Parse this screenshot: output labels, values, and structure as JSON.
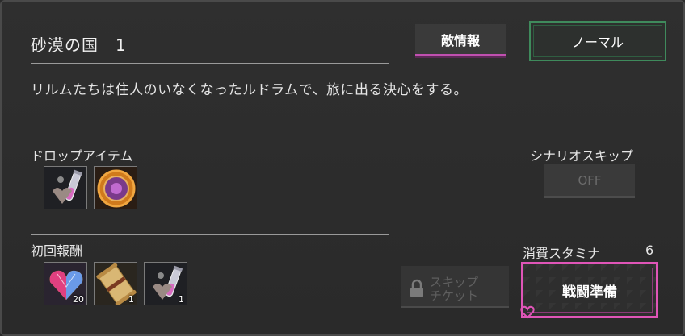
{
  "stage": {
    "title": "砂漠の国　1",
    "description": "リルムたちは住人のいなくなったルドラムで、旅に出る決心をする。"
  },
  "buttons": {
    "enemy_info": "敵情報",
    "difficulty": "ノーマル",
    "skip_ticket": [
      "スキップ",
      "チケット"
    ],
    "battle_prep": "戦闘準備"
  },
  "drop_items": {
    "label": "ドロップアイテム",
    "items": [
      {
        "icon": "potion-vial-icon"
      },
      {
        "icon": "orange-coin-icon"
      }
    ]
  },
  "first_reward": {
    "label": "初回報酬",
    "items": [
      {
        "icon": "rainbow-heart-gem-icon",
        "count": "20"
      },
      {
        "icon": "scroll-icon",
        "count": "1"
      },
      {
        "icon": "potion-vial-icon",
        "count": "1"
      }
    ]
  },
  "scenario_skip": {
    "label": "シナリオスキップ",
    "value": "OFF"
  },
  "stamina": {
    "label": "消費スタミナ",
    "value": "6"
  },
  "colors": {
    "accent_pink": "#e055b8",
    "accent_green": "#3f8a5c",
    "panel_bg": "#2b2b2b"
  }
}
